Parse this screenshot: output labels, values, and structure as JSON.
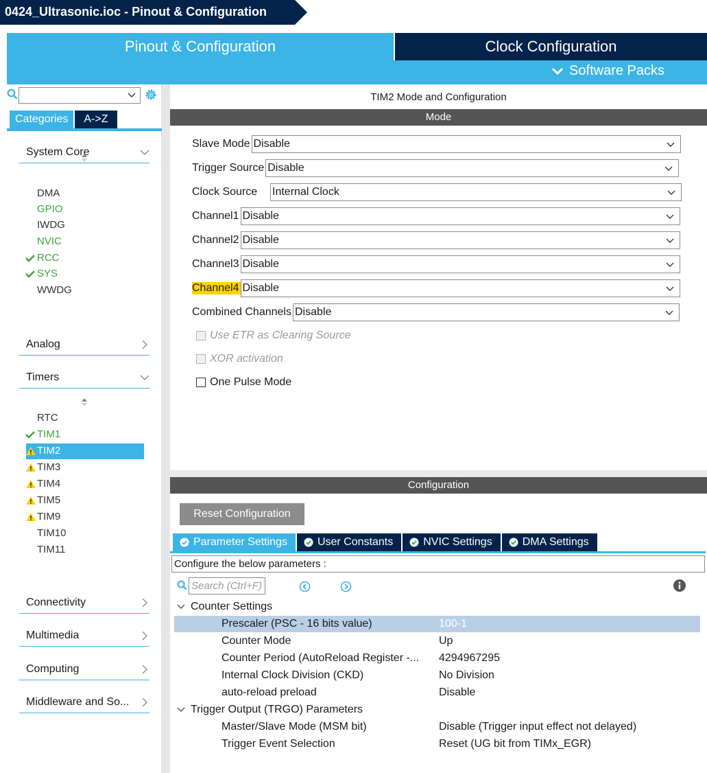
{
  "window": {
    "title": "0424_Ultrasonic.ioc - Pinout & Configuration"
  },
  "top_tabs": {
    "pinout": "Pinout & Configuration",
    "clock": "Clock Configuration",
    "software_packs": "Software Packs"
  },
  "sidebar": {
    "search_value": "",
    "tabs": {
      "categories": "Categories",
      "az": "A->Z"
    },
    "categories": {
      "system_core": {
        "label": "System Core",
        "items": [
          "DMA",
          "GPIO",
          "IWDG",
          "NVIC",
          "RCC",
          "SYS",
          "WWDG"
        ]
      },
      "analog": {
        "label": "Analog"
      },
      "timers": {
        "label": "Timers",
        "items": [
          "RTC",
          "TIM1",
          "TIM2",
          "TIM3",
          "TIM4",
          "TIM5",
          "TIM9",
          "TIM10",
          "TIM11"
        ]
      },
      "connectivity": {
        "label": "Connectivity"
      },
      "multimedia": {
        "label": "Multimedia"
      },
      "computing": {
        "label": "Computing"
      },
      "middleware": {
        "label": "Middleware and So..."
      }
    }
  },
  "main": {
    "title": "TIM2 Mode and Configuration",
    "mode_band": "Mode",
    "mode_fields": [
      {
        "label": "Slave Mode",
        "value": "Disable"
      },
      {
        "label": "Trigger Source",
        "value": "Disable"
      },
      {
        "label": "Clock Source",
        "value": "Internal Clock"
      },
      {
        "label": "Channel1",
        "value": "Disable"
      },
      {
        "label": "Channel2",
        "value": "Disable"
      },
      {
        "label": "Channel3",
        "value": "Disable"
      },
      {
        "label": "Channel4",
        "value": "Disable"
      },
      {
        "label": "Combined Channels",
        "value": "Disable"
      }
    ],
    "checkboxes": [
      {
        "label": "Use ETR as Clearing Source"
      },
      {
        "label": "XOR activation"
      },
      {
        "label": "One Pulse Mode"
      }
    ],
    "config_band": "Configuration",
    "reset_button": "Reset Configuration",
    "config_tabs": [
      "Parameter Settings",
      "User Constants",
      "NVIC Settings",
      "DMA Settings"
    ],
    "config_desc": "Configure the below parameters :",
    "param_search_placeholder": "Search (Ctrl+F)",
    "groups": [
      {
        "label": "Counter Settings",
        "params": [
          {
            "name": "Prescaler (PSC - 16 bits value)",
            "value": "100-1"
          },
          {
            "name": "Counter Mode",
            "value": "Up"
          },
          {
            "name": "Counter Period (AutoReload Register -...",
            "value": "4294967295"
          },
          {
            "name": "Internal Clock Division (CKD)",
            "value": "No Division"
          },
          {
            "name": "auto-reload preload",
            "value": "Disable"
          }
        ]
      },
      {
        "label": "Trigger Output (TRGO) Parameters",
        "params": [
          {
            "name": "Master/Slave Mode (MSM bit)",
            "value": "Disable (Trigger input effect not delayed)"
          },
          {
            "name": "Trigger Event Selection",
            "value": "Reset (UG bit from TIMx_EGR)"
          }
        ]
      }
    ]
  },
  "colors": {
    "navy": "#03234b",
    "accent": "#3cb4e6",
    "green": "#3da33d",
    "warning": "#ffd200"
  }
}
